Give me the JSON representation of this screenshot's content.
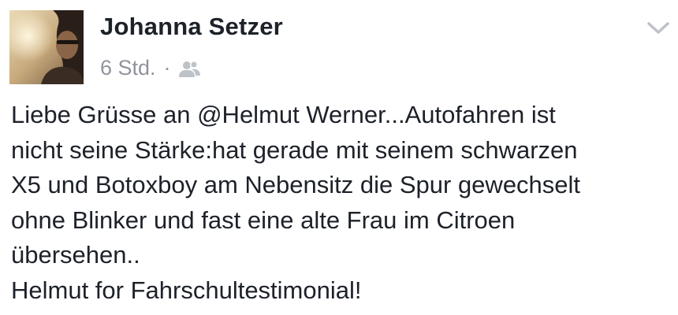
{
  "post": {
    "author_name": "Johanna Setzer",
    "timestamp": "6 Std.",
    "separator": "·",
    "audience_icon": "friends-icon",
    "menu_icon": "chevron-down-icon",
    "text_lines": [
      "Liebe Grüsse an @Helmut Werner...Autofahren ist",
      "nicht seine Stärke:hat gerade mit seinem schwarzen",
      "X5 und Botoxboy am Nebensitz die Spur gewechselt",
      "ohne Blinker und fast eine alte Frau im Citroen",
      "übersehen..",
      "Helmut for Fahrschultestimonial!"
    ]
  },
  "colors": {
    "text": "#1d2129",
    "meta": "#90949c",
    "icon": "#bec2c9",
    "background": "#ffffff"
  }
}
